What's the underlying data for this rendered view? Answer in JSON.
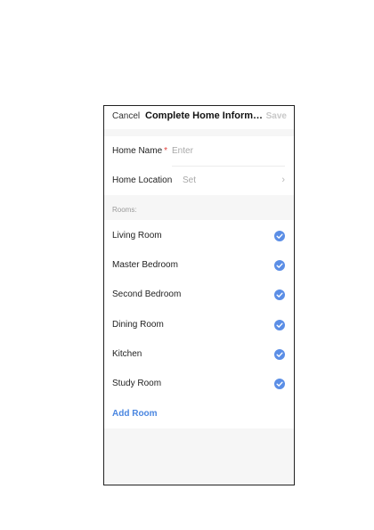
{
  "navbar": {
    "cancel_label": "Cancel",
    "title": "Complete Home Informati…",
    "save_label": "Save"
  },
  "form": {
    "home_name_label": "Home Name",
    "required_mark": "*",
    "home_name_placeholder": "Enter",
    "home_location_label": "Home Location",
    "home_location_value": "Set",
    "chevron": "›"
  },
  "rooms": {
    "section_label": "Rooms:",
    "items": [
      {
        "label": "Living Room",
        "checked": true
      },
      {
        "label": "Master Bedroom",
        "checked": true
      },
      {
        "label": "Second Bedroom",
        "checked": true
      },
      {
        "label": "Dining Room",
        "checked": true
      },
      {
        "label": "Kitchen",
        "checked": true
      },
      {
        "label": "Study Room",
        "checked": true
      }
    ],
    "add_room_label": "Add Room"
  },
  "colors": {
    "accent": "#4a86e0",
    "check": "#5b8ee6",
    "required": "#e2403b",
    "background": "#f6f6f6"
  }
}
